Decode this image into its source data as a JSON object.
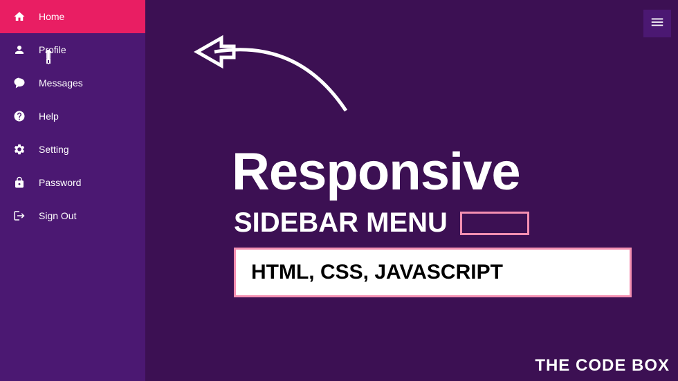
{
  "sidebar": {
    "items": [
      {
        "label": "Home",
        "icon": "home"
      },
      {
        "label": "Profile",
        "icon": "user"
      },
      {
        "label": "Messages",
        "icon": "comment"
      },
      {
        "label": "Help",
        "icon": "question"
      },
      {
        "label": "Setting",
        "icon": "gear"
      },
      {
        "label": "Password",
        "icon": "lock"
      },
      {
        "label": "Sign Out",
        "icon": "signout"
      }
    ]
  },
  "main": {
    "title": "Responsive",
    "subtitle": "SIDEBAR MENU",
    "tech": "HTML, CSS, JAVASCRIPT",
    "brand": "THE CODE BOX"
  }
}
